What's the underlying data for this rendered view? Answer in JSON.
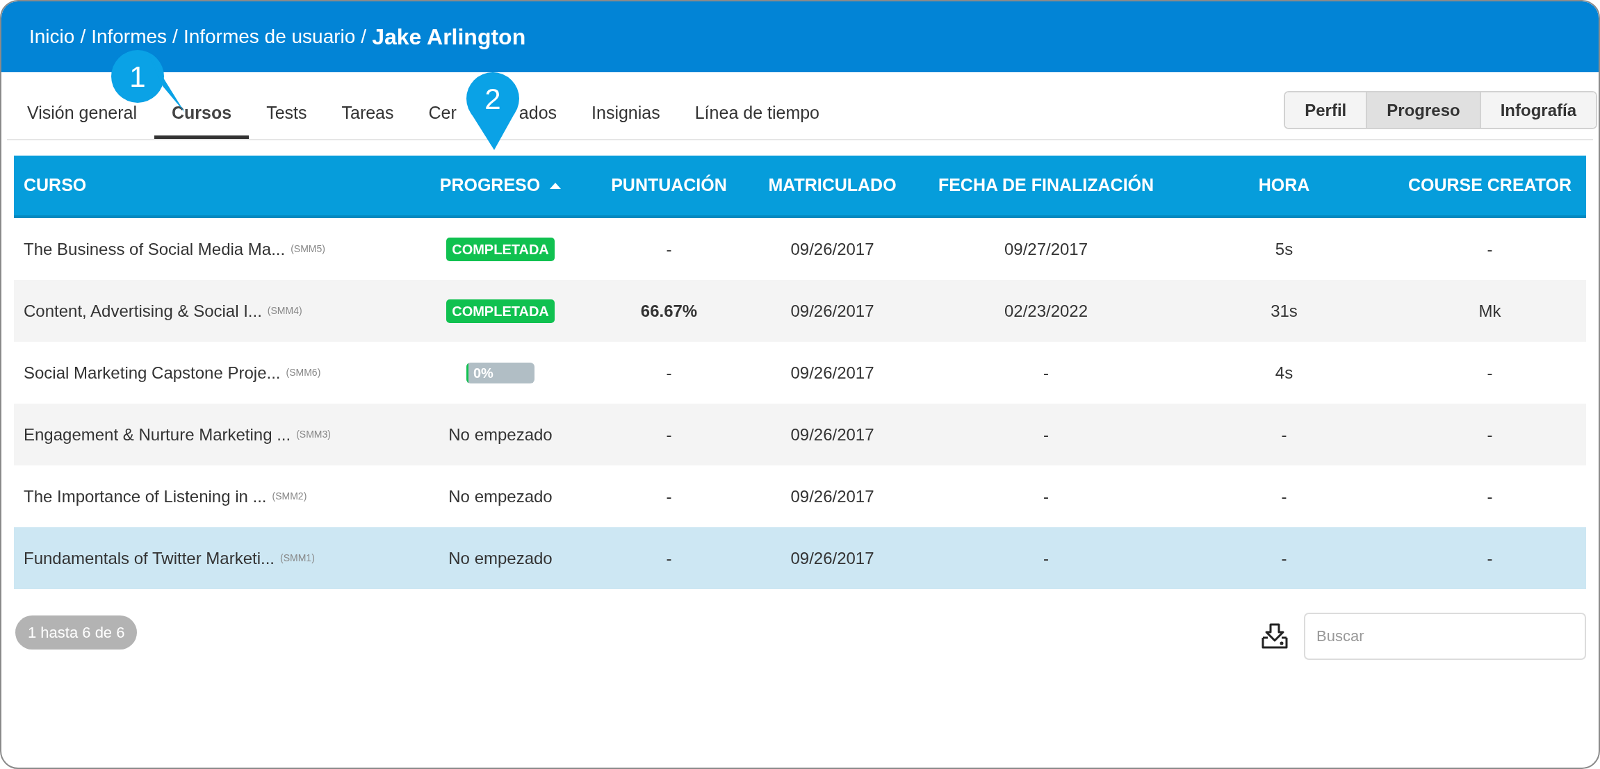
{
  "breadcrumb": {
    "separator": "/",
    "items": [
      "Inicio",
      "Informes",
      "Informes de usuario"
    ],
    "current": "Jake Arlington"
  },
  "tabs": [
    {
      "label": "Visión general",
      "selected": false
    },
    {
      "label": "Cursos",
      "selected": true
    },
    {
      "label": "Tests",
      "selected": false
    },
    {
      "label": "Tareas",
      "selected": false
    },
    {
      "label": "Cer",
      "label_after_callout": "ados",
      "selected": false
    },
    {
      "label": "Insignias",
      "selected": false
    },
    {
      "label": "Línea de tiempo",
      "selected": false
    }
  ],
  "view_buttons": [
    {
      "label": "Perfil",
      "selected": false
    },
    {
      "label": "Progreso",
      "selected": true
    },
    {
      "label": "Infografía",
      "selected": false
    }
  ],
  "callouts": [
    {
      "number": "1"
    },
    {
      "number": "2"
    }
  ],
  "table": {
    "columns": [
      {
        "label": "CURSO",
        "sorted": false
      },
      {
        "label": "PROGRESO",
        "sorted": true
      },
      {
        "label": "PUNTUACIÓN",
        "sorted": false
      },
      {
        "label": "MATRICULADO",
        "sorted": false
      },
      {
        "label": "FECHA DE FINALIZACIÓN",
        "sorted": false
      },
      {
        "label": "HORA",
        "sorted": false
      },
      {
        "label": "COURSE CREATOR",
        "sorted": false
      }
    ],
    "rows": [
      {
        "course": "The Business of Social Media Ma...",
        "code": "(SMM5)",
        "progress": {
          "kind": "badge",
          "text": "COMPLETADA"
        },
        "score": "-",
        "score_bold": false,
        "enrolled": "09/26/2017",
        "completed": "09/27/2017",
        "time": "5s",
        "creator": "-",
        "selected": false
      },
      {
        "course": "Content, Advertising & Social I...",
        "code": "(SMM4)",
        "progress": {
          "kind": "badge",
          "text": "COMPLETADA"
        },
        "score": "66.67%",
        "score_bold": true,
        "enrolled": "09/26/2017",
        "completed": "02/23/2022",
        "time": "31s",
        "creator": "Mk",
        "selected": false
      },
      {
        "course": "Social Marketing Capstone Proje...",
        "code": "(SMM6)",
        "progress": {
          "kind": "bar",
          "text": "0%",
          "level": 0.03
        },
        "score": "-",
        "score_bold": false,
        "enrolled": "09/26/2017",
        "completed": "-",
        "time": "4s",
        "creator": "-",
        "selected": false
      },
      {
        "course": "Engagement & Nurture Marketing ...",
        "code": "(SMM3)",
        "progress": {
          "kind": "text",
          "text": "No empezado"
        },
        "score": "-",
        "score_bold": false,
        "enrolled": "09/26/2017",
        "completed": "-",
        "time": "-",
        "creator": "-",
        "selected": false
      },
      {
        "course": "The Importance of Listening in ...",
        "code": "(SMM2)",
        "progress": {
          "kind": "text",
          "text": "No empezado"
        },
        "score": "-",
        "score_bold": false,
        "enrolled": "09/26/2017",
        "completed": "-",
        "time": "-",
        "creator": "-",
        "selected": false
      },
      {
        "course": "Fundamentals of Twitter Marketi...",
        "code": "(SMM1)",
        "progress": {
          "kind": "text",
          "text": "No empezado"
        },
        "score": "-",
        "score_bold": false,
        "enrolled": "09/26/2017",
        "completed": "-",
        "time": "-",
        "creator": "-",
        "selected": true
      }
    ]
  },
  "pagination": "1 hasta 6 de 6",
  "search": {
    "placeholder": "Buscar"
  }
}
